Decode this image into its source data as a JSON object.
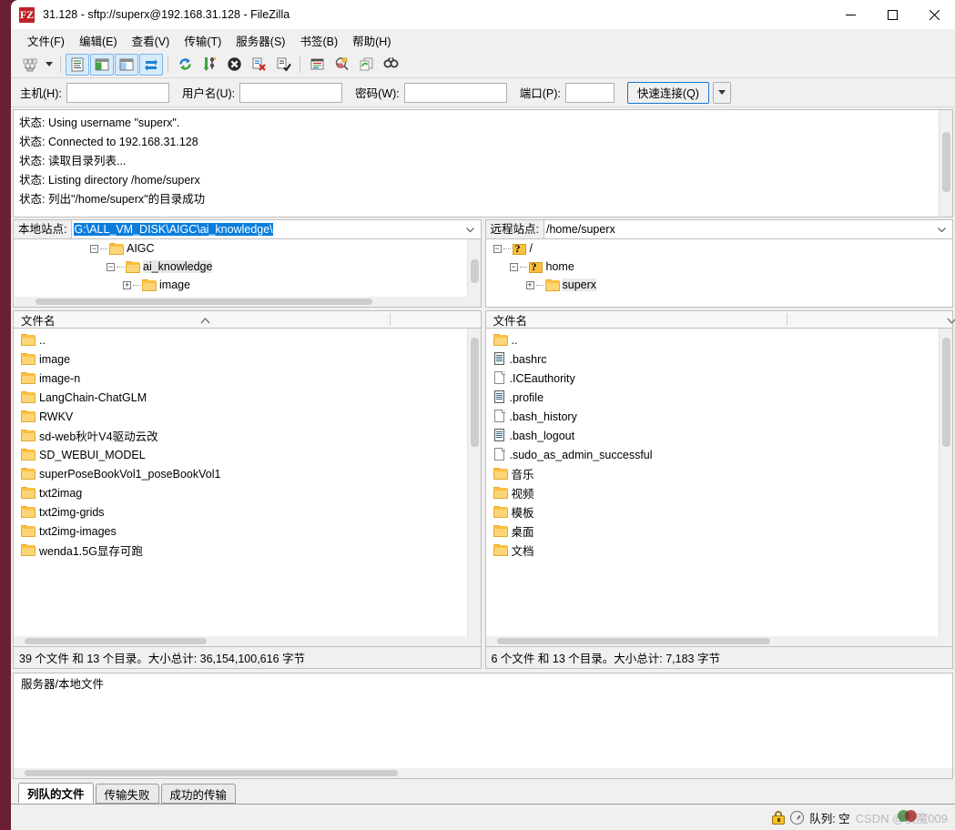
{
  "window": {
    "title": "31.128 - sftp://superx@192.168.31.128 - FileZilla",
    "logo": "filezilla-logo",
    "controls": {
      "minimize": "minimize-icon",
      "maximize": "maximize-icon",
      "close": "close-icon"
    }
  },
  "menu": {
    "items": [
      {
        "label": "文件(F)",
        "name": "menu-file"
      },
      {
        "label": "编辑(E)",
        "name": "menu-edit"
      },
      {
        "label": "查看(V)",
        "name": "menu-view"
      },
      {
        "label": "传输(T)",
        "name": "menu-transfer"
      },
      {
        "label": "服务器(S)",
        "name": "menu-server"
      },
      {
        "label": "书签(B)",
        "name": "menu-bookmarks"
      },
      {
        "label": "帮助(H)",
        "name": "menu-help"
      }
    ]
  },
  "toolbar": {
    "buttons": [
      "site-manager-icon",
      "toggle-message-log-icon",
      "toggle-local-tree-icon",
      "toggle-remote-tree-icon",
      "toggle-transfer-queue-icon",
      "refresh-icon",
      "process-queue-icon",
      "cancel-operation-icon",
      "disconnect-icon",
      "reconnect-icon",
      "filter-icon",
      "directory-compare-icon",
      "synchronized-browsing-icon",
      "search-remote-files-icon"
    ]
  },
  "quickconnect": {
    "host_label": "主机(H):",
    "host_value": "",
    "user_label": "用户名(U):",
    "user_value": "",
    "pass_label": "密码(W):",
    "pass_value": "",
    "port_label": "端口(P):",
    "port_value": "",
    "connect_label": "快速连接(Q)",
    "dropdown": "chevron-down-icon"
  },
  "log": {
    "lines": [
      {
        "prefix": "状态:",
        "text": "Using username \"superx\"."
      },
      {
        "prefix": "状态:",
        "text": "Connected to 192.168.31.128"
      },
      {
        "prefix": "状态:",
        "text": "读取目录列表..."
      },
      {
        "prefix": "状态:",
        "text": "Listing directory /home/superx"
      },
      {
        "prefix": "状态:",
        "text": "列出\"/home/superx\"的目录成功"
      }
    ]
  },
  "local": {
    "site_label": "本地站点:",
    "path": "G:\\ALL_VM_DISK\\AIGC\\ai_knowledge\\",
    "tree": [
      {
        "label": "AIGC",
        "depth": 3,
        "expander": "−",
        "icon": "folder-icon",
        "selected": false
      },
      {
        "label": "ai_knowledge",
        "depth": 4,
        "expander": "−",
        "icon": "folder-icon",
        "selected": true
      },
      {
        "label": "image",
        "depth": 5,
        "expander": "+",
        "icon": "folder-icon",
        "selected": false
      }
    ],
    "column_header": "文件名",
    "sort": "ascending",
    "files": [
      {
        "name": "..",
        "icon": "folder-icon"
      },
      {
        "name": "image",
        "icon": "folder-icon"
      },
      {
        "name": "image-n",
        "icon": "folder-icon"
      },
      {
        "name": "LangChain-ChatGLM",
        "icon": "folder-icon"
      },
      {
        "name": "RWKV",
        "icon": "folder-icon"
      },
      {
        "name": "sd-web秋叶V4驱动云改",
        "icon": "folder-icon"
      },
      {
        "name": "SD_WEBUI_MODEL",
        "icon": "folder-icon"
      },
      {
        "name": "superPoseBookVol1_poseBookVol1",
        "icon": "folder-icon"
      },
      {
        "name": "txt2imag",
        "icon": "folder-icon"
      },
      {
        "name": "txt2img-grids",
        "icon": "folder-icon"
      },
      {
        "name": "txt2img-images",
        "icon": "folder-icon"
      },
      {
        "name": "wenda1.5G显存可跑",
        "icon": "folder-icon"
      }
    ],
    "status": "39 个文件 和 13 个目录。大小总计: 36,154,100,616 字节"
  },
  "remote": {
    "site_label": "远程站点:",
    "path": "/home/superx",
    "tree": [
      {
        "label": "/",
        "depth": 0,
        "expander": "−",
        "icon": "unknown-folder-icon",
        "selected": false
      },
      {
        "label": "home",
        "depth": 1,
        "expander": "−",
        "icon": "unknown-folder-icon",
        "selected": false
      },
      {
        "label": "superx",
        "depth": 2,
        "expander": "+",
        "icon": "folder-icon",
        "selected": true
      }
    ],
    "column_header": "文件名",
    "sort": "descending",
    "files": [
      {
        "name": "..",
        "icon": "folder-icon"
      },
      {
        "name": ".bashrc",
        "icon": "text-file-icon"
      },
      {
        "name": ".ICEauthority",
        "icon": "blank-file-icon"
      },
      {
        "name": ".profile",
        "icon": "text-file-icon"
      },
      {
        "name": ".bash_history",
        "icon": "blank-file-icon"
      },
      {
        "name": ".bash_logout",
        "icon": "text-file-icon"
      },
      {
        "name": ".sudo_as_admin_successful",
        "icon": "blank-file-icon"
      },
      {
        "name": "音乐",
        "icon": "folder-icon"
      },
      {
        "name": "视频",
        "icon": "folder-icon"
      },
      {
        "name": "模板",
        "icon": "folder-icon"
      },
      {
        "name": "桌面",
        "icon": "folder-icon"
      },
      {
        "name": "文档",
        "icon": "folder-icon"
      }
    ],
    "status": "6 个文件 和 13 个目录。大小总计: 7,183 字节"
  },
  "queue": {
    "header": "服务器/本地文件",
    "tabs": [
      {
        "label": "列队的文件",
        "active": true
      },
      {
        "label": "传输失败",
        "active": false
      },
      {
        "label": "成功的传输",
        "active": false
      }
    ]
  },
  "statusbar": {
    "lock": "lock-icon",
    "speed": "speed-gauge-icon",
    "queue_text": "队列: 空",
    "watermark": "CSDN @夜魔009"
  }
}
